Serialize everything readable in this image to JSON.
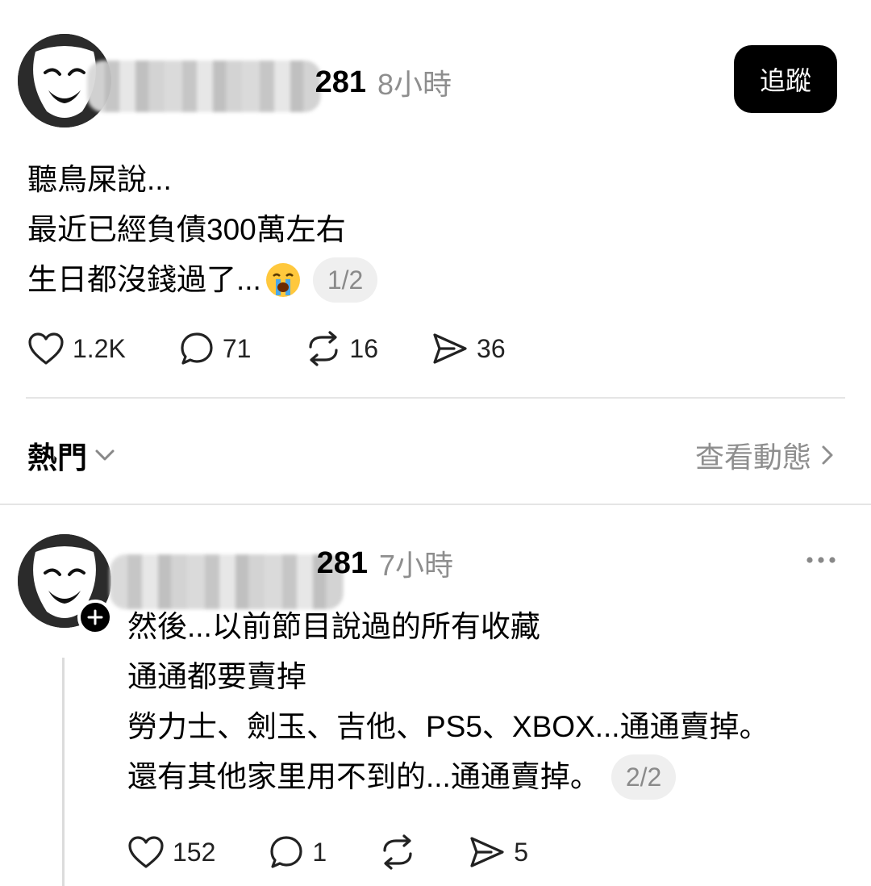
{
  "post": {
    "username_visible_suffix": "281",
    "timestamp": "8小時",
    "follow_label": "追蹤",
    "text_lines": [
      "聽鳥屎說...",
      "最近已經負債300萬左右",
      "生日都沒錢過了..."
    ],
    "emoji": "loudly-crying-face",
    "page_indicator": "1/2",
    "likes": "1.2K",
    "comments": "71",
    "reposts": "16",
    "shares": "36"
  },
  "section": {
    "sort_label": "熱門",
    "view_activity_label": "查看動態"
  },
  "reply": {
    "username_visible_suffix": "281",
    "timestamp": "7小時",
    "text_lines": [
      "然後...以前節目說過的所有收藏",
      "通通都要賣掉",
      "勞力士、劍玉、吉他、PS5、XBOX...通通賣掉。",
      "還有其他家里用不到的...通通賣掉。"
    ],
    "page_indicator": "2/2",
    "likes": "152",
    "comments": "1",
    "shares": "5"
  },
  "icons": {
    "like": "heart-icon",
    "comment": "speech-bubble-icon",
    "repost": "repost-icon",
    "share": "paper-plane-icon",
    "more": "more-dots-icon",
    "follow_plus": "plus-icon",
    "chevron_down": "chevron-down-icon",
    "chevron_right": "chevron-right-icon"
  },
  "colors": {
    "text": "#000000",
    "muted": "#8e8e8e",
    "button_bg": "#000000",
    "badge_bg": "#efefef",
    "divider": "#e5e5e5"
  }
}
